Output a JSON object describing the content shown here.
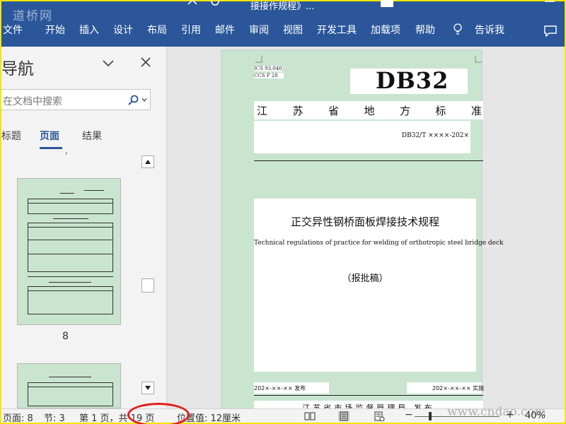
{
  "window": {
    "watermark_text": "道桥网",
    "title": "接接作规程》..."
  },
  "ribbon": {
    "tabs": [
      "文件",
      "开始",
      "插入",
      "设计",
      "布局",
      "引用",
      "邮件",
      "审阅",
      "视图",
      "开发工具",
      "加载项",
      "帮助"
    ],
    "tell_me": "告诉我",
    "accent_color": "#2b579a"
  },
  "nav_pane": {
    "title": "导航",
    "search_placeholder": "在文档中搜索",
    "tabs": [
      "标题",
      "页面",
      "结果"
    ],
    "active_tab": "页面",
    "thumbnail_page": "8"
  },
  "document": {
    "ics": "ICS  93.040",
    "ccs": "CCS P 28",
    "db_code": "DB32",
    "standard_type_chars": [
      "江",
      "苏",
      "省",
      "地",
      "方",
      "标",
      "准"
    ],
    "standard_number": "DB32/T  ××××-202×",
    "title_cn": "正交异性钢桥面板焊接技术规程",
    "title_en": "Technical regulations of practice for welding of orthotropic steel bridge deck",
    "draft_status": "（报批稿）",
    "publish_date": "202×-××-×× 发布",
    "implement_date": "202×-××-××  实施",
    "issuer": "江苏省市场监督管理局   发布",
    "page_color": "#c9e4cf"
  },
  "status_bar": {
    "page_count": "页面: 8",
    "section": "节: 3",
    "page_of": "第 1 页，共 19 页",
    "position": "位置值: 12厘米",
    "zoom_minus": "−",
    "zoom_plus": "+",
    "zoom": "40%",
    "site_watermark": "www.cndao.com",
    "zoom_fraction": 0.4
  }
}
